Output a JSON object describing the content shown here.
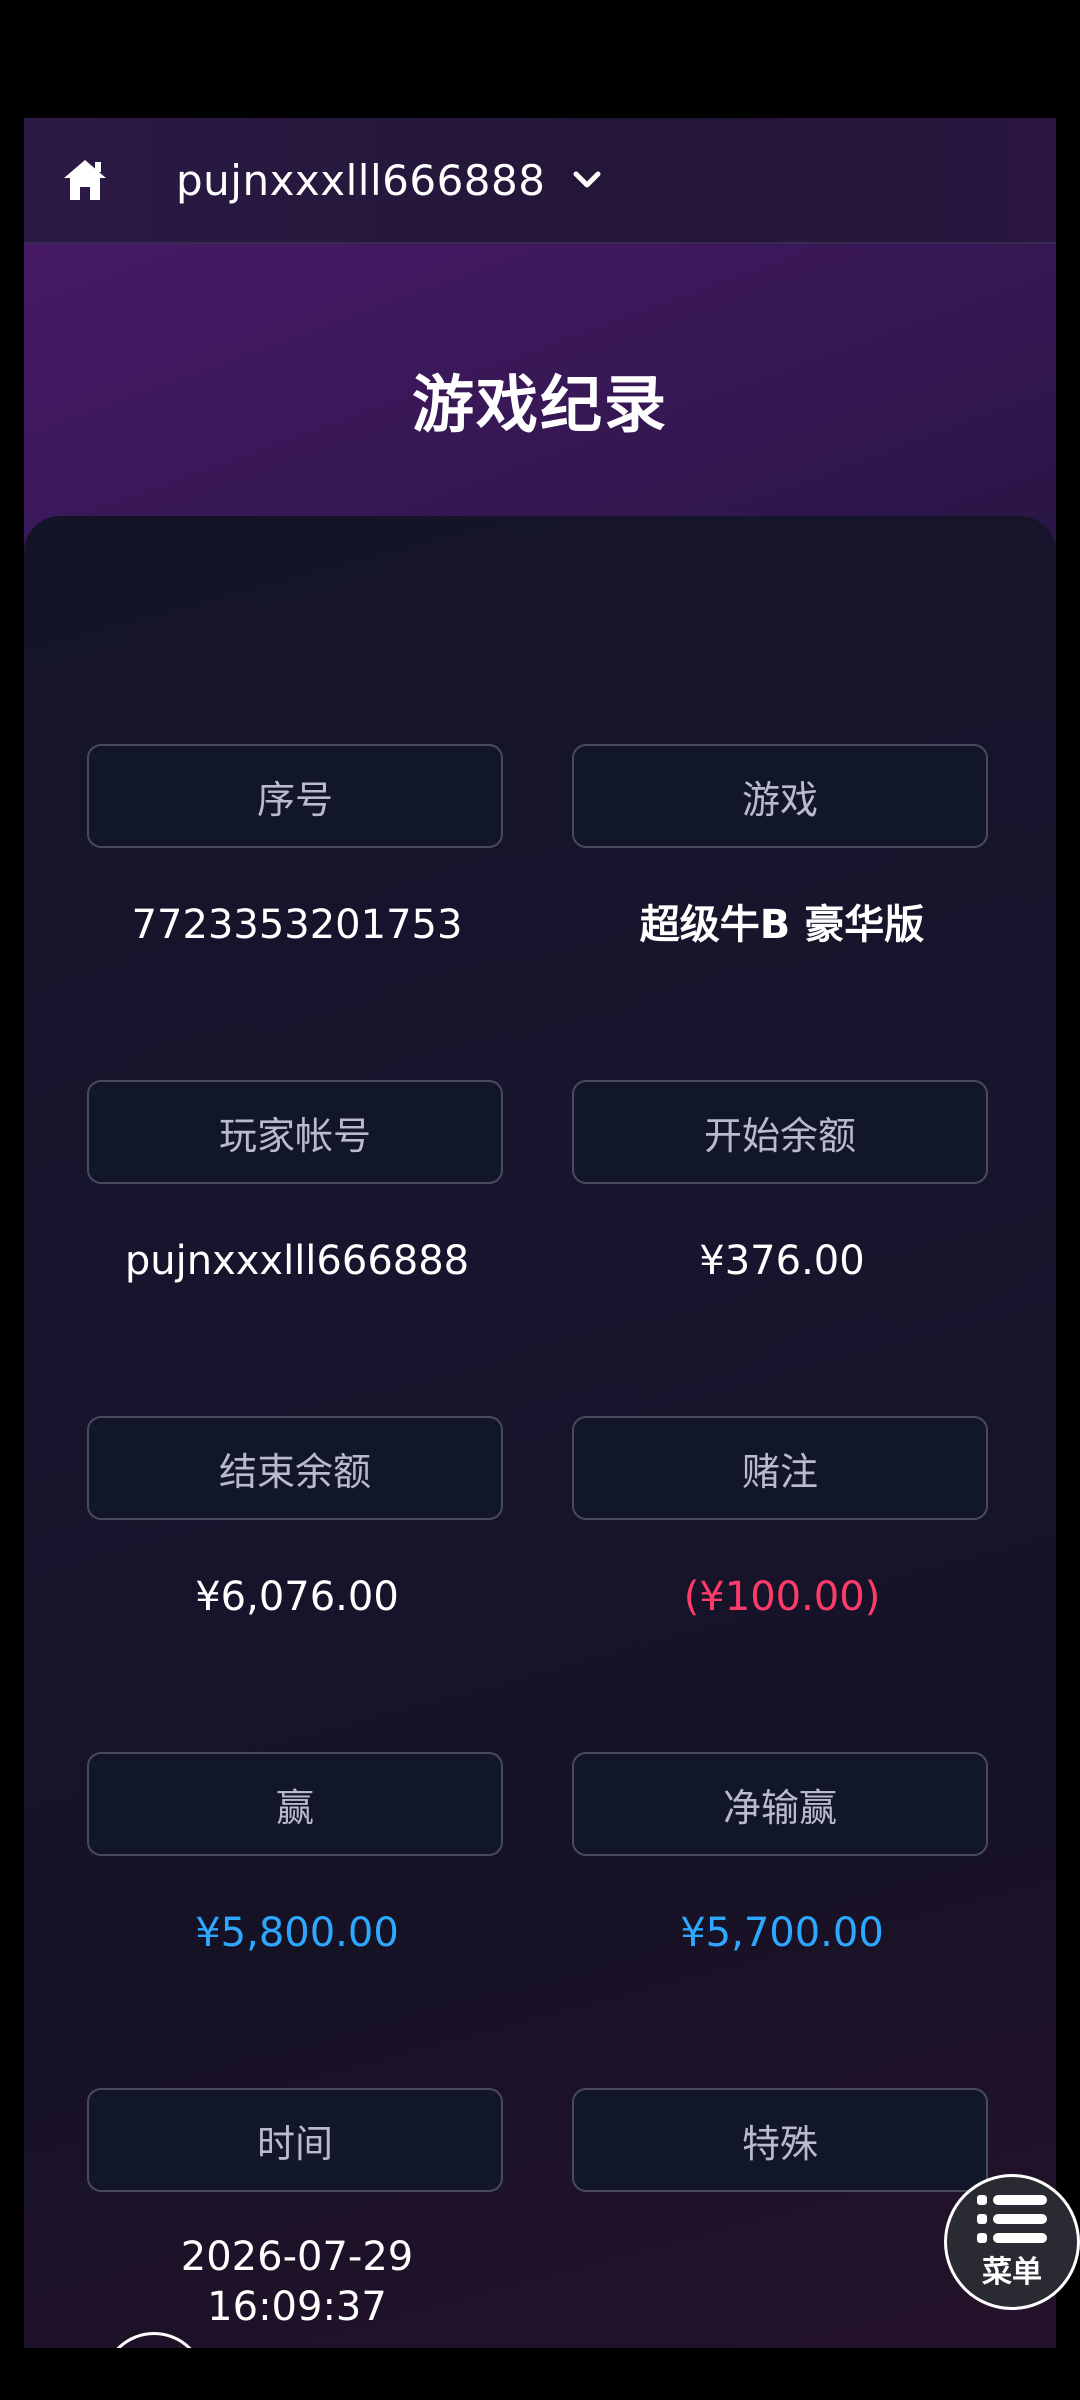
{
  "header": {
    "account": "pujnxxxlll666888"
  },
  "title": "游戏纪录",
  "record": {
    "rows": [
      {
        "left": {
          "label": "序号",
          "value": "7723353201753",
          "tone": "white"
        },
        "right": {
          "label": "游戏",
          "value": "超级牛B 豪华版",
          "tone": "white"
        }
      },
      {
        "left": {
          "label": "玩家帐号",
          "value": "pujnxxxlll666888",
          "tone": "white"
        },
        "right": {
          "label": "开始余额",
          "value": "¥376.00",
          "tone": "white"
        }
      },
      {
        "left": {
          "label": "结束余额",
          "value": "¥6,076.00",
          "tone": "white"
        },
        "right": {
          "label": "赌注",
          "value": "(¥100.00)",
          "tone": "red"
        }
      },
      {
        "left": {
          "label": "赢",
          "value": "¥5,800.00",
          "tone": "blue"
        },
        "right": {
          "label": "净输赢",
          "value": "¥5,700.00",
          "tone": "blue"
        }
      },
      {
        "left": {
          "label": "时间",
          "value": "2026-07-29\n16:09:37",
          "tone": "white"
        },
        "right": {
          "label": "特殊",
          "value": "",
          "tone": "white"
        }
      }
    ]
  },
  "menu": {
    "label": "菜单"
  },
  "colors": {
    "negative": "#ff3b6b",
    "positive": "#2ea8ff",
    "label_text": "#b9b9cf"
  },
  "icons": {
    "home": "home-icon",
    "dropdown": "chevron-down-icon",
    "back": "arrow-left-icon",
    "menu": "list-icon"
  }
}
